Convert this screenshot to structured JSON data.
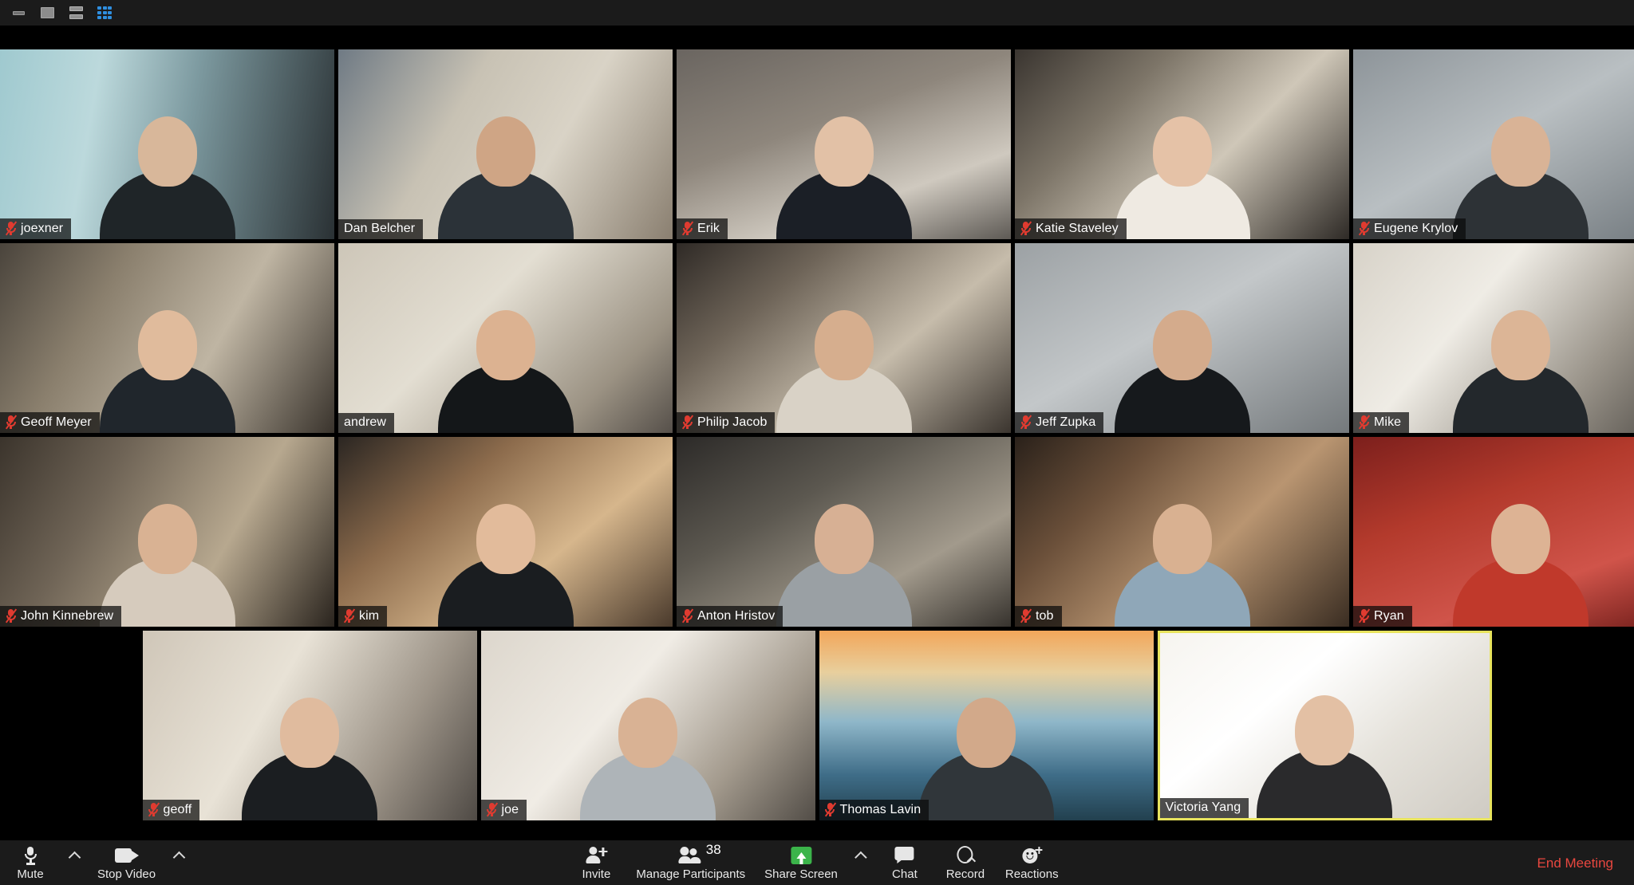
{
  "window": {
    "controls": [
      {
        "name": "minimize",
        "icon": "minimize-icon"
      },
      {
        "name": "maximize",
        "icon": "maximize-icon"
      },
      {
        "name": "speaker-view",
        "icon": "speaker-view-icon"
      },
      {
        "name": "gallery-view",
        "icon": "gallery-view-icon",
        "active": true
      }
    ],
    "accent_active": "#2f8fe0",
    "chrome_bg": "#1b1b1b"
  },
  "meeting": {
    "active_speaker_border": "#e8e45e",
    "muted_icon_color": "#e03b30",
    "participant_count": "38",
    "rows": [
      {
        "tiles": [
          {
            "name": "joexner",
            "muted": true,
            "speaking": false
          },
          {
            "name": "Dan Belcher",
            "muted": false,
            "speaking": false
          },
          {
            "name": "Erik",
            "muted": true,
            "speaking": false
          },
          {
            "name": "Katie Staveley",
            "muted": true,
            "speaking": false
          },
          {
            "name": "Eugene Krylov",
            "muted": true,
            "speaking": false
          }
        ]
      },
      {
        "tiles": [
          {
            "name": "Geoff Meyer",
            "muted": true,
            "speaking": false
          },
          {
            "name": "andrew",
            "muted": false,
            "speaking": false
          },
          {
            "name": "Philip Jacob",
            "muted": true,
            "speaking": false
          },
          {
            "name": "Jeff Zupka",
            "muted": true,
            "speaking": false
          },
          {
            "name": "Mike",
            "muted": true,
            "speaking": false
          }
        ]
      },
      {
        "tiles": [
          {
            "name": "John Kinnebrew",
            "muted": true,
            "speaking": false
          },
          {
            "name": "kim",
            "muted": true,
            "speaking": false
          },
          {
            "name": "Anton Hristov",
            "muted": true,
            "speaking": false
          },
          {
            "name": "tob",
            "muted": true,
            "speaking": false
          },
          {
            "name": "Ryan",
            "muted": true,
            "speaking": false
          }
        ]
      },
      {
        "tiles": [
          {
            "name": "geoff",
            "muted": true,
            "speaking": false
          },
          {
            "name": "joe",
            "muted": true,
            "speaking": false
          },
          {
            "name": "Thomas Lavin",
            "muted": true,
            "speaking": false
          },
          {
            "name": "Victoria Yang",
            "muted": false,
            "speaking": true
          }
        ]
      }
    ]
  },
  "toolbar": {
    "bg": "#1b1b1b",
    "left": [
      {
        "label": "Mute",
        "icon": "microphone-icon",
        "has_caret": true
      },
      {
        "label": "Stop Video",
        "icon": "camera-icon",
        "has_caret": true
      }
    ],
    "center": [
      {
        "label": "Invite",
        "icon": "invite-person-icon",
        "has_caret": false
      },
      {
        "label": "Manage Participants",
        "icon": "people-icon",
        "badge": "38",
        "has_caret": false
      },
      {
        "label": "Share Screen",
        "icon": "share-screen-icon",
        "has_caret": true,
        "accent": "#3bb44a"
      },
      {
        "label": "Chat",
        "icon": "chat-bubble-icon",
        "has_caret": false
      },
      {
        "label": "Record",
        "icon": "record-icon",
        "has_caret": false
      },
      {
        "label": "Reactions",
        "icon": "reactions-smiley-icon",
        "has_caret": false
      }
    ],
    "end_meeting_label": "End Meeting",
    "end_meeting_color": "#e8473f"
  }
}
